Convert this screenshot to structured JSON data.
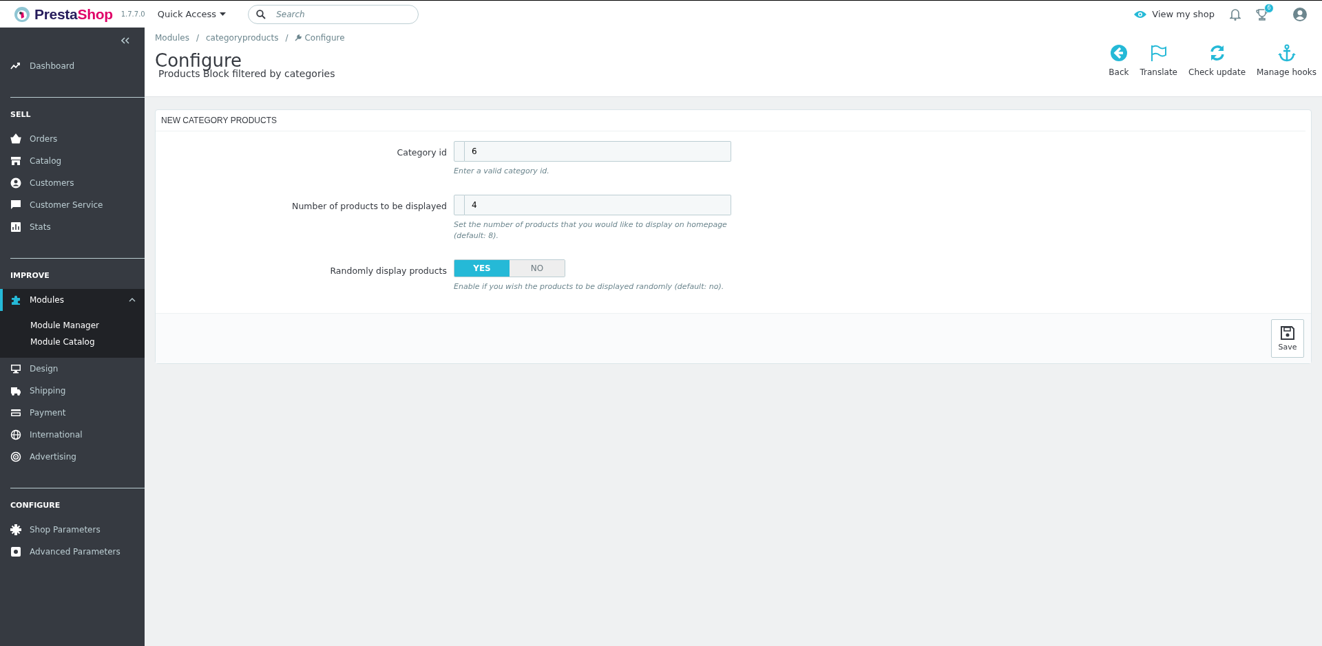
{
  "topbar": {
    "logo": {
      "text_dark": "Presta",
      "text_accent": "Shop"
    },
    "version": "1.7.7.0",
    "quick_access": "Quick Access",
    "search": {
      "placeholder": "Search"
    },
    "view_shop": "View my shop",
    "trophy_badge": "6"
  },
  "sidebar": {
    "sections": [
      {
        "items": [
          {
            "label": "Dashboard",
            "selected": false,
            "expanded": false
          }
        ]
      },
      {
        "heading": "SELL",
        "items": [
          {
            "label": "Orders",
            "selected": false,
            "expanded": false
          },
          {
            "label": "Catalog",
            "selected": false,
            "expanded": false
          },
          {
            "label": "Customers",
            "selected": false,
            "expanded": false
          },
          {
            "label": "Customer Service",
            "selected": false,
            "expanded": false
          },
          {
            "label": "Stats",
            "selected": false,
            "expanded": false
          }
        ]
      },
      {
        "heading": "IMPROVE",
        "items": [
          {
            "label": "Modules",
            "selected": true,
            "expanded": true,
            "children": [
              {
                "label": "Module Manager"
              },
              {
                "label": "Module Catalog"
              }
            ]
          },
          {
            "label": "Design",
            "selected": false,
            "expanded": false
          },
          {
            "label": "Shipping",
            "selected": false,
            "expanded": false
          },
          {
            "label": "Payment",
            "selected": false,
            "expanded": false
          },
          {
            "label": "International",
            "selected": false,
            "expanded": false
          },
          {
            "label": "Advertising",
            "selected": false,
            "expanded": false
          }
        ]
      },
      {
        "heading": "CONFIGURE",
        "items": [
          {
            "label": "Shop Parameters",
            "selected": false,
            "expanded": false
          },
          {
            "label": "Advanced Parameters",
            "selected": false,
            "expanded": false
          }
        ]
      }
    ]
  },
  "header": {
    "breadcrumb": [
      {
        "label": "Modules",
        "separator": "/"
      },
      {
        "label": "categoryproducts",
        "separator": "/"
      },
      {
        "label": "Configure"
      }
    ],
    "title": "Configure",
    "subtitle": "Products Block filtered by categories",
    "toolbar": [
      "Back",
      "Translate",
      "Check update",
      "Manage hooks"
    ]
  },
  "panel": {
    "heading": "NEW CATEGORY PRODUCTS",
    "fields": [
      {
        "kind": "text",
        "label": "Category id",
        "value": "6",
        "help": "Enter a valid category id."
      },
      {
        "kind": "text",
        "label": "Number of products to be displayed",
        "value": "4",
        "help": "Set the number of products that you would like to display on homepage (default: 8)."
      },
      {
        "kind": "switch",
        "label": "Randomly display products",
        "options": [
          {
            "label": "YES",
            "selected": true
          },
          {
            "label": "NO",
            "selected": false
          }
        ],
        "help": "Enable if you wish the products to be displayed randomly (default: no)."
      }
    ],
    "save": "Save"
  }
}
